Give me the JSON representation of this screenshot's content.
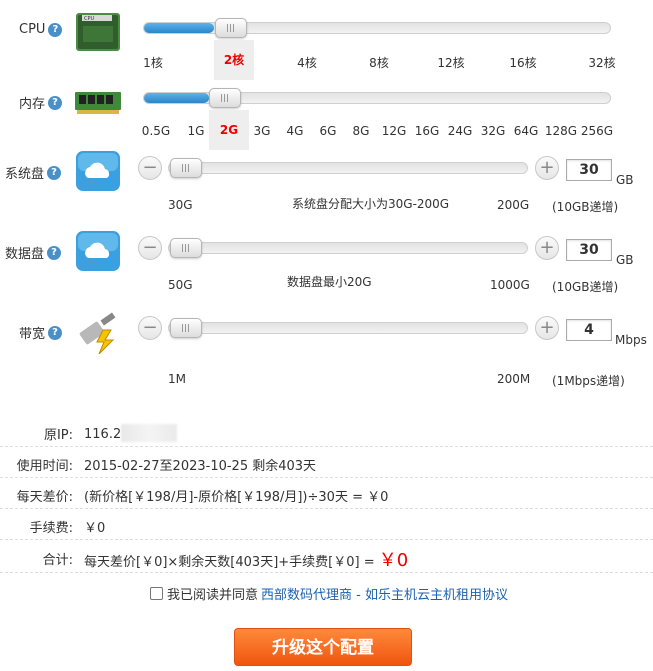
{
  "cpu": {
    "label": "CPU",
    "chip_text": "CPU",
    "ticks": [
      "1核",
      "2核",
      "4核",
      "8核",
      "12核",
      "16核",
      "32核"
    ],
    "selected": "2核"
  },
  "memory": {
    "label": "内存",
    "ticks": [
      "0.5G",
      "1G",
      "2G",
      "3G",
      "4G",
      "6G",
      "8G",
      "12G",
      "16G",
      "24G",
      "32G",
      "64G",
      "128G",
      "256G"
    ],
    "selected": "2G"
  },
  "system_disk": {
    "label": "系统盘",
    "value": "30",
    "unit": "GB",
    "min": "30G",
    "max": "200G",
    "note": "系统盘分配大小为30G-200G",
    "step": "(10GB递增)",
    "minus": "−",
    "plus": "+"
  },
  "data_disk": {
    "label": "数据盘",
    "value": "30",
    "unit": "GB",
    "min": "50G",
    "max": "1000G",
    "note": "数据盘最小20G",
    "step": "(10GB递增)",
    "minus": "−",
    "plus": "+"
  },
  "bandwidth": {
    "label": "带宽",
    "value": "4",
    "unit": "Mbps",
    "min": "1M",
    "max": "200M",
    "step": "(1Mbps递增)",
    "minus": "−",
    "plus": "+"
  },
  "info": {
    "ip_label": "原IP:",
    "ip_value": "116.2",
    "time_label": "使用时间:",
    "time_value": "2015-02-27至2023-10-25  剩余403天",
    "diff_label": "每天差价:",
    "diff_value": "(新价格[￥198/月]-原价格[￥198/月])÷30天 = ￥0",
    "fee_label": "手续费:",
    "fee_value": "￥0",
    "total_label": "合计:",
    "total_formula": "每天差价[￥0]×剩余天数[403天]+手续费[￥0] = ",
    "total_price": "￥0"
  },
  "agreement": {
    "text": "我已阅读并同意",
    "link": "西部数码代理商 - 如乐主机云主机租用协议"
  },
  "upgrade_button": "升级这个配置",
  "help_glyph": "?",
  "colors": {
    "accent_blue": "#2b86c9",
    "selected_red": "#e00000",
    "button_orange": "#f0550f",
    "link_blue": "#1b62b0"
  },
  "levels": {
    "cpu_fill": 0.15,
    "memory_fill": 0.14,
    "system_disk_fill": 0.0,
    "data_disk_fill": 0.0,
    "bandwidth_fill": 0.0
  }
}
